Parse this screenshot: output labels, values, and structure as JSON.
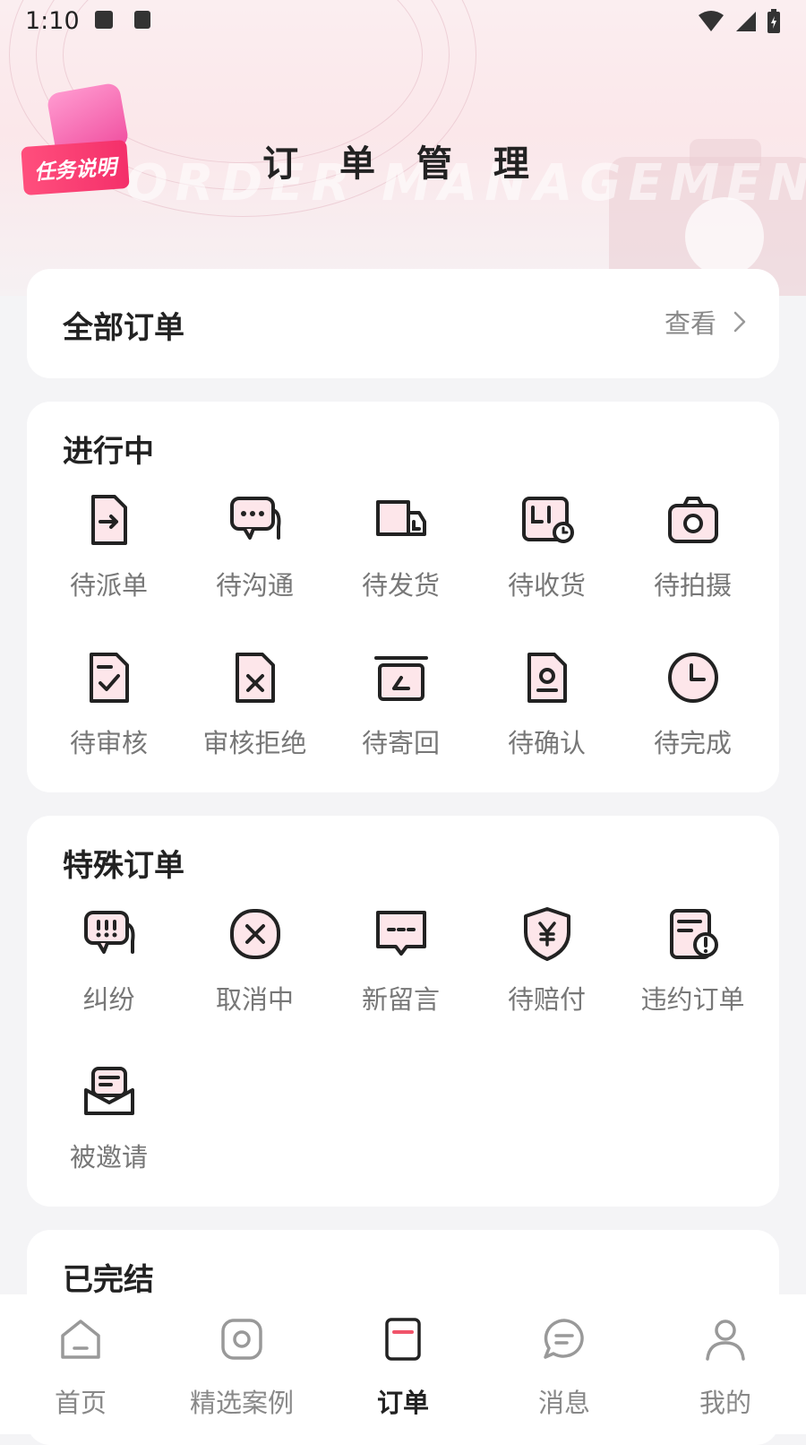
{
  "status_bar": {
    "time": "1:10"
  },
  "header": {
    "badge_text": "任务说明",
    "title": "订 单 管 理",
    "watermark": "ORDER MANAGEMENT"
  },
  "all_orders": {
    "title": "全部订单",
    "view_label": "查看"
  },
  "in_progress": {
    "title": "进行中",
    "items": [
      {
        "label": "待派单",
        "icon": "dispatch-icon"
      },
      {
        "label": "待沟通",
        "icon": "chat-icon"
      },
      {
        "label": "待发货",
        "icon": "truck-icon"
      },
      {
        "label": "待收货",
        "icon": "receive-icon"
      },
      {
        "label": "待拍摄",
        "icon": "camera-icon"
      },
      {
        "label": "待审核",
        "icon": "review-icon"
      },
      {
        "label": "审核拒绝",
        "icon": "reject-icon"
      },
      {
        "label": "待寄回",
        "icon": "return-icon"
      },
      {
        "label": "待确认",
        "icon": "confirm-icon"
      },
      {
        "label": "待完成",
        "icon": "clock-icon"
      }
    ]
  },
  "special": {
    "title": "特殊订单",
    "items": [
      {
        "label": "纠纷",
        "icon": "dispute-icon"
      },
      {
        "label": "取消中",
        "icon": "cancel-icon"
      },
      {
        "label": "新留言",
        "icon": "message-icon"
      },
      {
        "label": "待赔付",
        "icon": "compensation-icon"
      },
      {
        "label": "违约订单",
        "icon": "breach-icon"
      },
      {
        "label": "被邀请",
        "icon": "invited-icon"
      }
    ]
  },
  "finished": {
    "title": "已完结"
  },
  "tabbar": {
    "items": [
      {
        "label": "首页",
        "icon": "home-icon"
      },
      {
        "label": "精选案例",
        "icon": "featured-icon"
      },
      {
        "label": "订单",
        "icon": "order-icon",
        "active": true
      },
      {
        "label": "消息",
        "icon": "chat-bubble-icon"
      },
      {
        "label": "我的",
        "icon": "profile-icon"
      }
    ]
  },
  "colors": {
    "accent": "#f0546a",
    "icon_fill": "#fde6ea",
    "icon_stroke": "#222222"
  }
}
